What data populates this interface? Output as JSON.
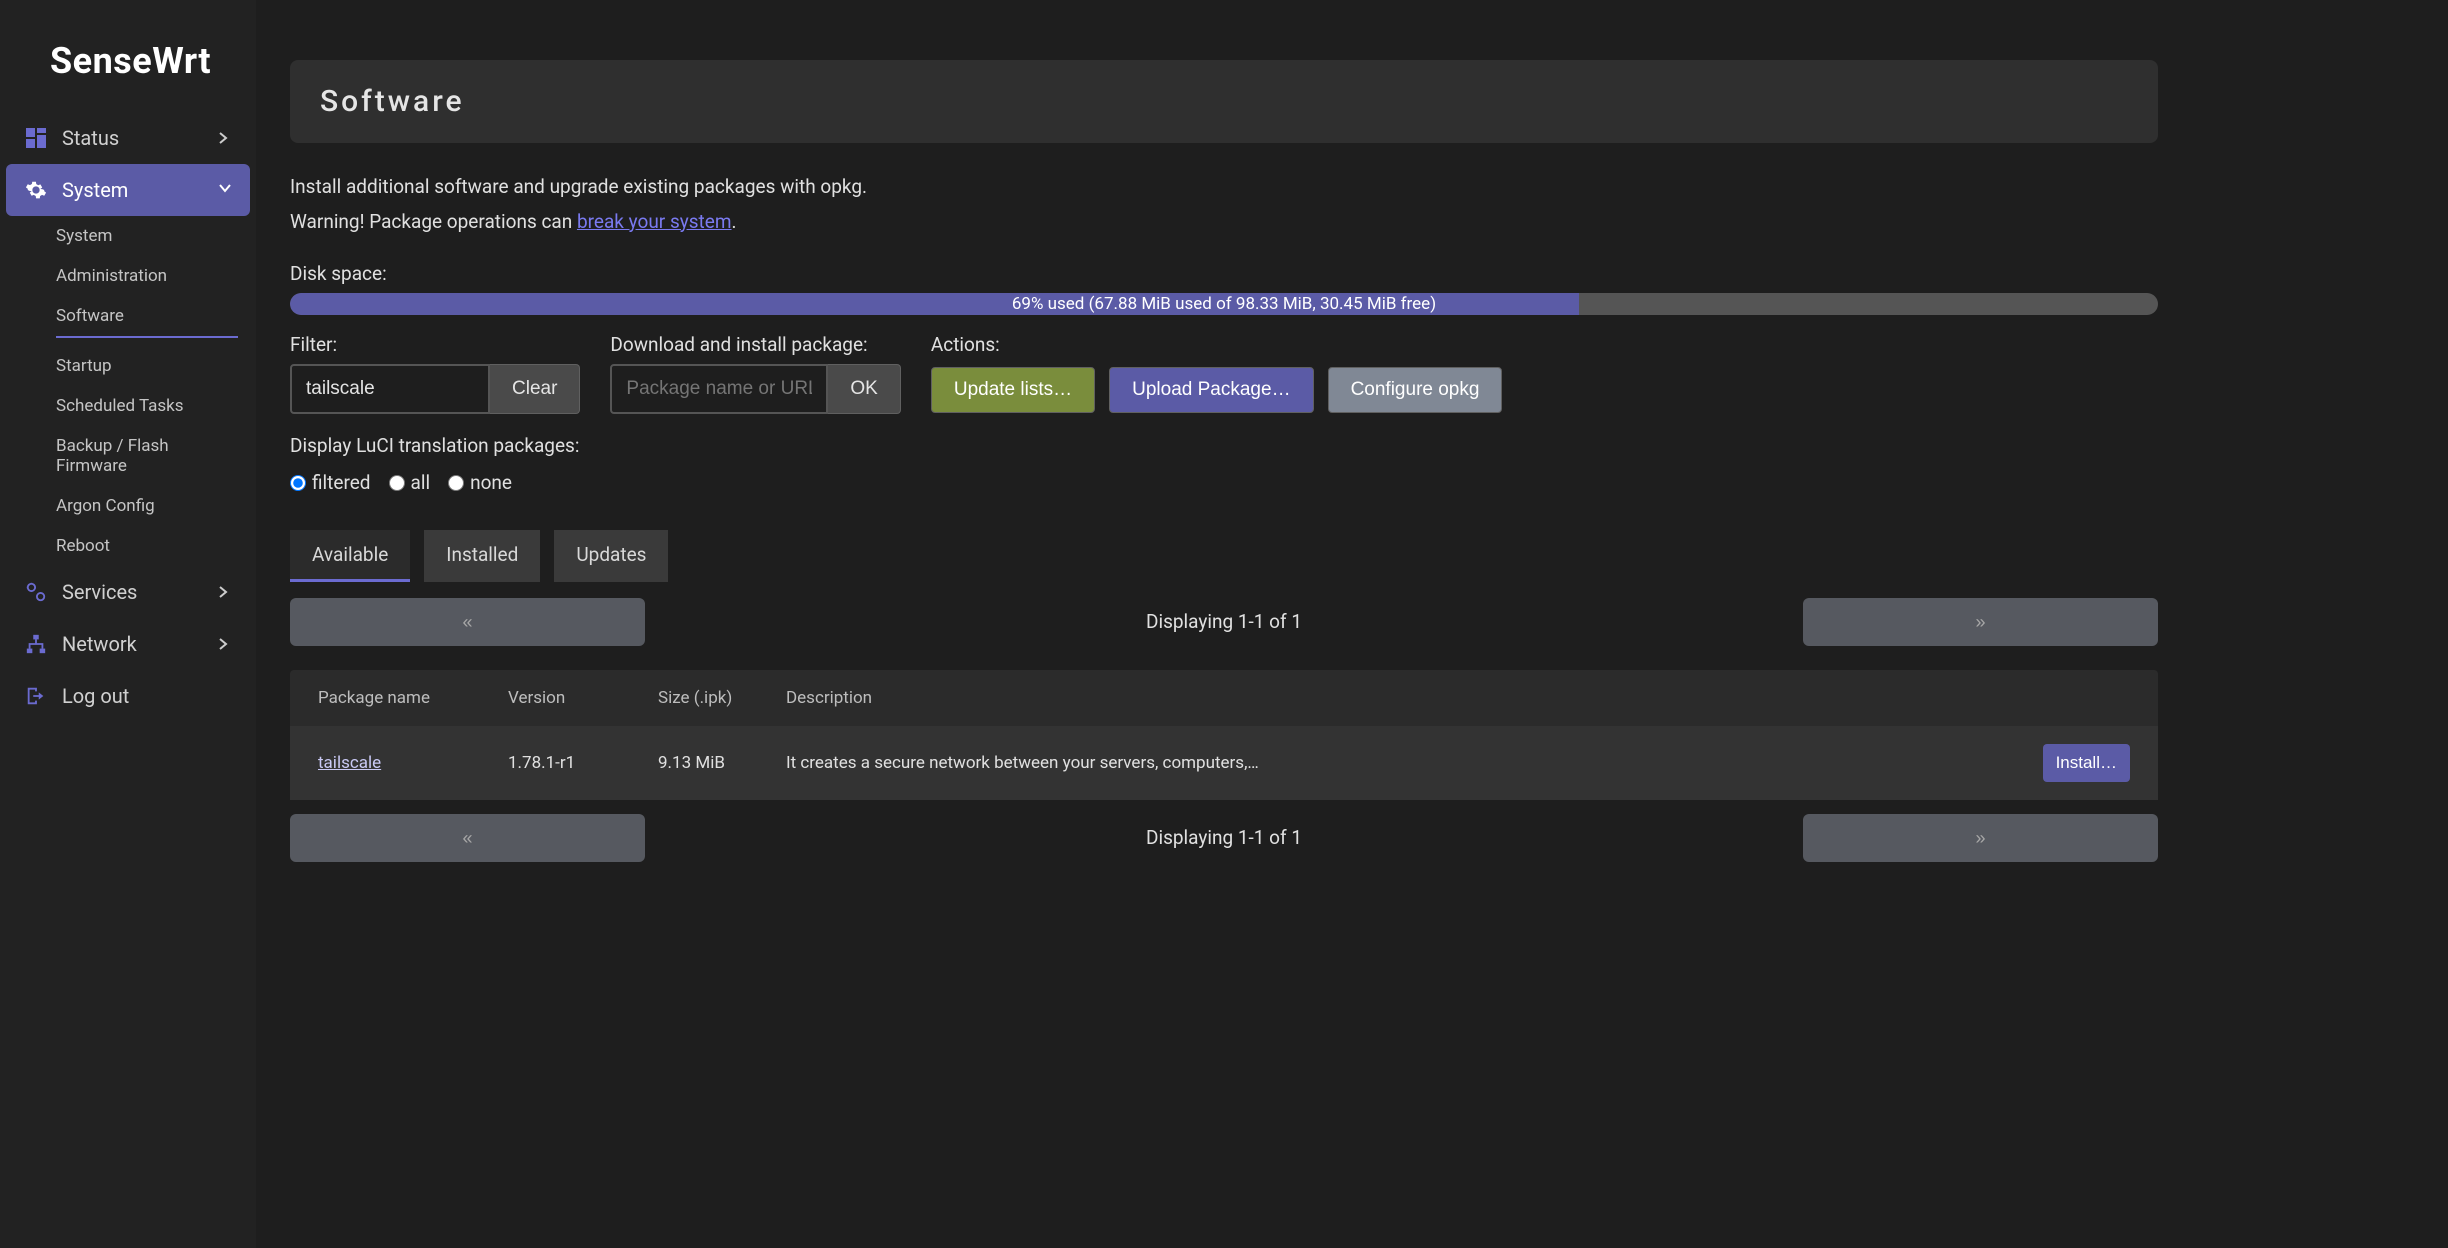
{
  "brand": "SenseWrt",
  "sidebar": {
    "items": [
      {
        "label": "Status",
        "icon": "dashboard-icon",
        "expanded": false
      },
      {
        "label": "System",
        "icon": "gear-icon",
        "expanded": true,
        "children": [
          {
            "label": "System"
          },
          {
            "label": "Administration"
          },
          {
            "label": "Software",
            "active": true
          },
          {
            "label": "Startup"
          },
          {
            "label": "Scheduled Tasks"
          },
          {
            "label": "Backup / Flash Firmware"
          },
          {
            "label": "Argon Config"
          },
          {
            "label": "Reboot"
          }
        ]
      },
      {
        "label": "Services",
        "icon": "services-icon",
        "expanded": false
      },
      {
        "label": "Network",
        "icon": "network-icon",
        "expanded": false
      },
      {
        "label": "Log out",
        "icon": "logout-icon",
        "expanded": null
      }
    ]
  },
  "page": {
    "title": "Software",
    "intro_1": "Install additional software and upgrade existing packages with opkg.",
    "intro_2_prefix": "Warning! Package operations can ",
    "intro_2_link": "break your system",
    "intro_2_suffix": "."
  },
  "disk": {
    "label": "Disk space:",
    "percent": 69,
    "text": "69% used (67.88 MiB used of 98.33 MiB, 30.45 MiB free)"
  },
  "filter": {
    "label": "Filter:",
    "value": "tailscale",
    "clear_label": "Clear"
  },
  "download": {
    "label": "Download and install package:",
    "placeholder": "Package name or URL…",
    "ok_label": "OK"
  },
  "actions": {
    "label": "Actions:",
    "update_label": "Update lists…",
    "upload_label": "Upload Package…",
    "configure_label": "Configure opkg"
  },
  "translation": {
    "label": "Display LuCI translation packages:",
    "options": [
      "filtered",
      "all",
      "none"
    ],
    "selected": "filtered"
  },
  "tabs": {
    "items": [
      "Available",
      "Installed",
      "Updates"
    ],
    "active": 0
  },
  "pager": {
    "prev": "«",
    "next": "»",
    "status": "Displaying 1-1 of 1"
  },
  "table": {
    "headers": [
      "Package name",
      "Version",
      "Size (.ipk)",
      "Description",
      ""
    ],
    "rows": [
      {
        "name": "tailscale",
        "version": "1.78.1-r1",
        "size": "9.13 MiB",
        "description": "It creates a secure network between your servers, computers,…",
        "action_label": "Install…"
      }
    ]
  }
}
